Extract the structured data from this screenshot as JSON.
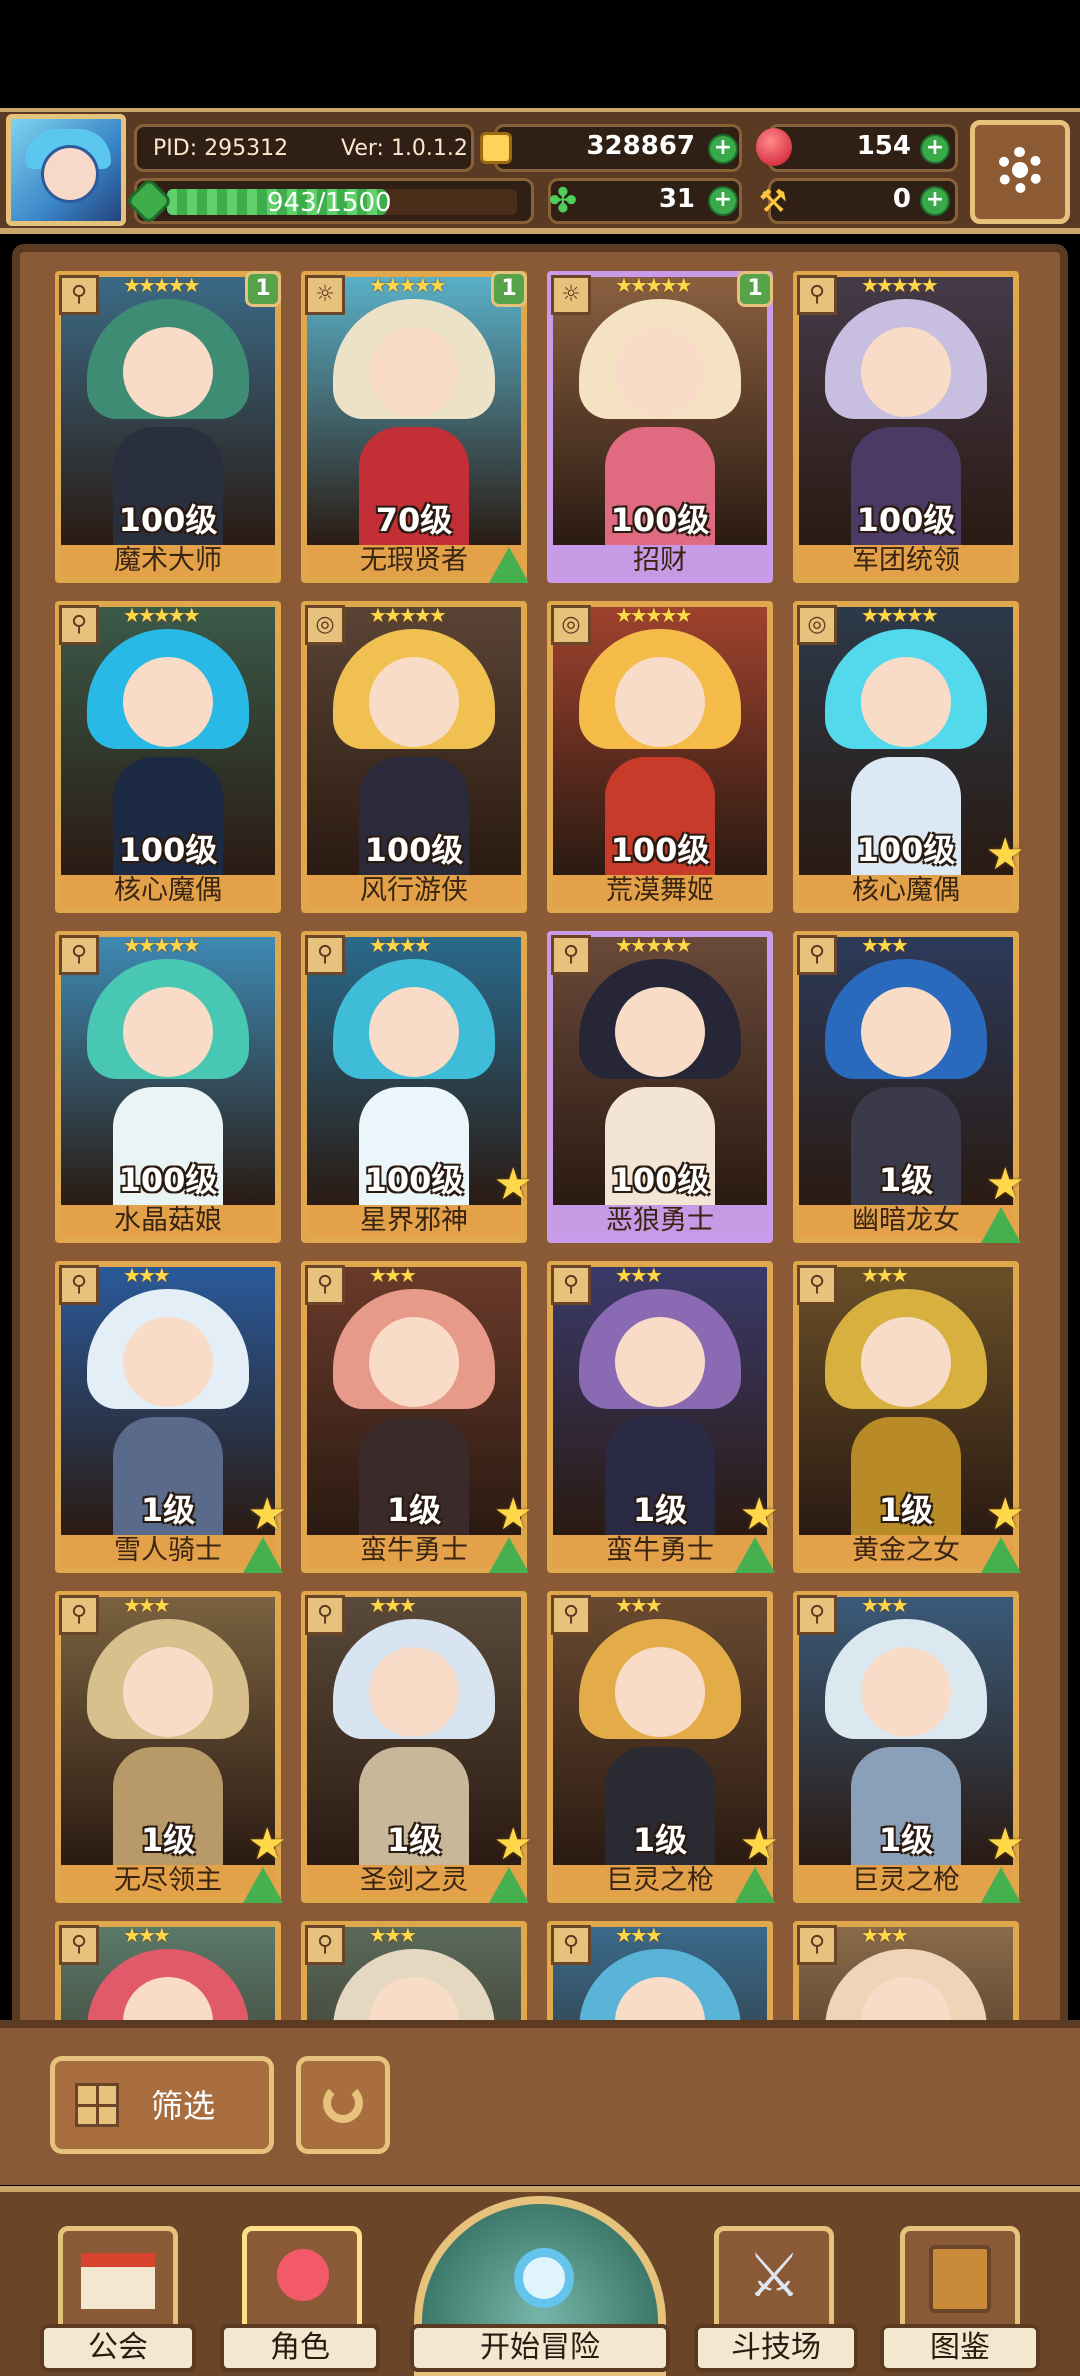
{
  "header": {
    "pid": "PID: 295312",
    "version": "Ver: 1.0.1.2",
    "gold": "328867",
    "gems": "154",
    "exp": "943/1500",
    "exp_fraction": 0.6287,
    "clover": "31",
    "hammer": "0"
  },
  "heroes": [
    {
      "name": "魔术大师",
      "level": "100级",
      "stars": "★★★★★",
      "badge": "1",
      "element": "⚲",
      "frame": "gold",
      "hair": "#3e8c74",
      "body": "#2a2f3e",
      "bg": "#3b6a86",
      "upgrade": false
    },
    {
      "name": "无瑕贤者",
      "level": "70级",
      "stars": "★★★★★",
      "badge": "1",
      "element": "☼",
      "frame": "gold",
      "hair": "#ece2c8",
      "body": "#c22f36",
      "bg": "#5ab0c8",
      "upgrade": true
    },
    {
      "name": "招财",
      "level": "100级",
      "stars": "★★★★★",
      "badge": "1",
      "element": "☼",
      "frame": "purple",
      "hair": "#f4e2c2",
      "body": "#e06a80",
      "bg": "#8a6040",
      "upgrade": false
    },
    {
      "name": "军团统领",
      "level": "100级",
      "stars": "★★★★★",
      "badge": "",
      "element": "⚲",
      "frame": "gold",
      "hair": "#c8bee0",
      "body": "#4a3a64",
      "bg": "#453a4a",
      "upgrade": false
    },
    {
      "name": "核心魔偶",
      "level": "100级",
      "stars": "★★★★★",
      "badge": "",
      "element": "⚲",
      "frame": "gold",
      "hair": "#29b9e6",
      "body": "#1c2a44",
      "bg": "#3a5a4a",
      "upgrade": false
    },
    {
      "name": "风行游侠",
      "level": "100级",
      "stars": "★★★★★",
      "badge": "",
      "element": "◎",
      "frame": "gold",
      "hair": "#f0c050",
      "body": "#2a2a3a",
      "bg": "#5a4434",
      "upgrade": false
    },
    {
      "name": "荒漠舞姬",
      "level": "100级",
      "stars": "★★★★★",
      "badge": "",
      "element": "◎",
      "frame": "gold",
      "hair": "#f4bb48",
      "body": "#c83a2a",
      "bg": "#a0422e",
      "upgrade": false
    },
    {
      "name": "核心魔偶",
      "level": "100级",
      "stars": "★★★★★",
      "badge": "",
      "element": "◎",
      "frame": "gold",
      "hair": "#54d8ec",
      "body": "#dce8f4",
      "bg": "#2c3a4a",
      "upgrade": false,
      "star_up": true
    },
    {
      "name": "水晶菇娘",
      "level": "100级",
      "stars": "★★★★★",
      "badge": "",
      "element": "⚲",
      "frame": "gold",
      "hair": "#48c8b2",
      "body": "#eaf4f4",
      "bg": "#3e8ab4",
      "upgrade": false
    },
    {
      "name": "星界邪神",
      "level": "100级",
      "stars": "★★★★",
      "badge": "",
      "element": "⚲",
      "frame": "gold",
      "hair": "#3ebcd8",
      "body": "#eaf6fa",
      "bg": "#2a6a8c",
      "upgrade": false,
      "star_up": true
    },
    {
      "name": "恶狼勇士",
      "level": "100级",
      "stars": "★★★★★",
      "badge": "",
      "element": "⚲",
      "frame": "purple",
      "hair": "#262636",
      "body": "#f4e4d4",
      "bg": "#6a4a3a",
      "upgrade": false
    },
    {
      "name": "幽暗龙女",
      "level": "1级",
      "stars": "★★★",
      "badge": "",
      "element": "⚲",
      "frame": "gold",
      "hair": "#2a6abc",
      "body": "#3a3a4a",
      "bg": "#2c3a5a",
      "upgrade": true,
      "star_up": true
    },
    {
      "name": "雪人骑士",
      "level": "1级",
      "stars": "★★★",
      "badge": "",
      "element": "⚲",
      "frame": "gold",
      "hair": "#e4eef6",
      "body": "#5a6a8a",
      "bg": "#2a5a9a",
      "upgrade": true,
      "star_up": true
    },
    {
      "name": "蛮牛勇士",
      "level": "1级",
      "stars": "★★★",
      "badge": "",
      "element": "⚲",
      "frame": "gold",
      "hair": "#e89a8a",
      "body": "#3a2a2a",
      "bg": "#6a3a2a",
      "upgrade": true,
      "star_up": true
    },
    {
      "name": "蛮牛勇士",
      "level": "1级",
      "stars": "★★★",
      "badge": "",
      "element": "⚲",
      "frame": "gold",
      "hair": "#8a6ab2",
      "body": "#2a2a44",
      "bg": "#3a3a6a",
      "upgrade": true,
      "star_up": true
    },
    {
      "name": "黄金之女",
      "level": "1级",
      "stars": "★★★",
      "badge": "",
      "element": "⚲",
      "frame": "gold",
      "hair": "#d8b040",
      "body": "#b88a28",
      "bg": "#6a5028",
      "upgrade": true,
      "star_up": true
    },
    {
      "name": "无尽领主",
      "level": "1级",
      "stars": "★★★",
      "badge": "",
      "element": "⚲",
      "frame": "gold",
      "hair": "#d8c08c",
      "body": "#b89a68",
      "bg": "#7a6240",
      "upgrade": true,
      "star_up": true
    },
    {
      "name": "圣剑之灵",
      "level": "1级",
      "stars": "★★★",
      "badge": "",
      "element": "⚲",
      "frame": "gold",
      "hair": "#d8e4f0",
      "body": "#c8b89a",
      "bg": "#5a4a3a",
      "upgrade": true,
      "star_up": true
    },
    {
      "name": "巨灵之枪",
      "level": "1级",
      "stars": "★★★",
      "badge": "",
      "element": "⚲",
      "frame": "gold",
      "hair": "#e4ac48",
      "body": "#2a2a32",
      "bg": "#6a4a30",
      "upgrade": true,
      "star_up": true
    },
    {
      "name": "巨灵之枪",
      "level": "1级",
      "stars": "★★★",
      "badge": "",
      "element": "⚲",
      "frame": "gold",
      "hair": "#dce8f0",
      "body": "#8aa0b8",
      "bg": "#3a5a7a",
      "upgrade": true,
      "star_up": true
    },
    {
      "name": "",
      "level": "",
      "stars": "★★★",
      "badge": "",
      "element": "⚲",
      "frame": "gold",
      "hair": "#e05a6a",
      "body": "#6a4a3a",
      "bg": "#5a7a6a",
      "upgrade": false
    },
    {
      "name": "",
      "level": "",
      "stars": "★★★",
      "badge": "",
      "element": "⚲",
      "frame": "gold",
      "hair": "#e4d8c0",
      "body": "#6a4a3a",
      "bg": "#5a6a5a",
      "upgrade": false
    },
    {
      "name": "",
      "level": "",
      "stars": "★★★",
      "badge": "",
      "element": "⚲",
      "frame": "gold",
      "hair": "#5ab4d8",
      "body": "#6a4a3a",
      "bg": "#3a6a8a",
      "upgrade": false
    },
    {
      "name": "",
      "level": "",
      "stars": "★★★",
      "badge": "",
      "element": "⚲",
      "frame": "gold",
      "hair": "#f0d4b8",
      "body": "#6a4a3a",
      "bg": "#8a6a4a",
      "upgrade": false
    }
  ],
  "controls": {
    "filter_label": "筛选"
  },
  "nav": {
    "guild": "公会",
    "character": "角色",
    "adventure": "开始冒险",
    "arena": "斗技场",
    "codex": "图鉴"
  }
}
